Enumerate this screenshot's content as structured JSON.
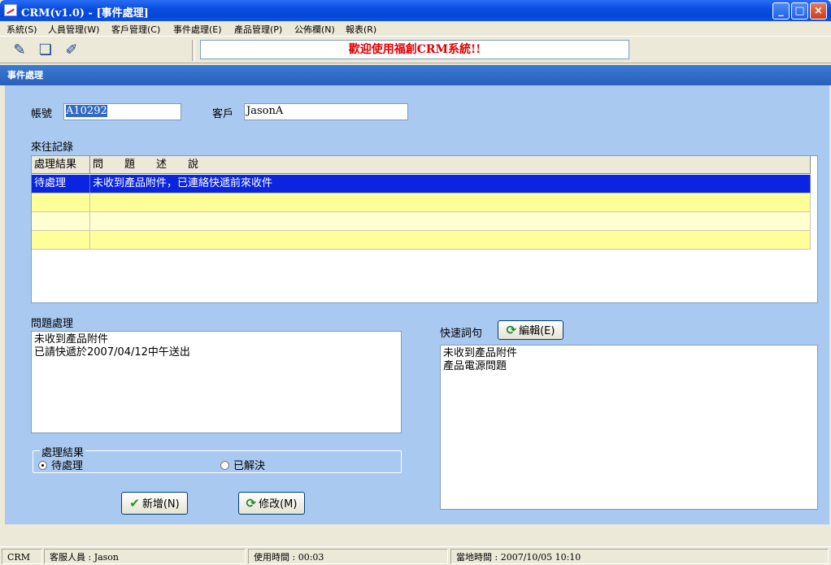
{
  "window": {
    "title": "CRM(v1.0) - [事件處理]",
    "controls": {
      "minimize": "_",
      "maximize": "□",
      "close": "×"
    }
  },
  "menu": [
    "系統(S)",
    "人員管理(W)",
    "客戶管理(C)",
    "事件處理(E)",
    "產品管理(P)",
    "公佈欄(N)",
    "報表(R)"
  ],
  "toolbar": {
    "icons": [
      "edit-icon",
      "book-icon",
      "notepad-icon"
    ],
    "welcome": "歡迎使用福創CRM系統!!"
  },
  "form": {
    "title": "事件處理",
    "account_label": "帳號",
    "account_value": "A10292",
    "customer_label": "客戶",
    "customer_value": "JasonA",
    "records_label": "來往記錄",
    "grid": {
      "headers": [
        "處理結果",
        "問　　題　　述　　說"
      ],
      "rows": [
        [
          "待處理",
          "未收到產品附件，已連絡快遞前來收件"
        ],
        [
          "",
          ""
        ],
        [
          "",
          ""
        ],
        [
          "",
          ""
        ]
      ]
    },
    "problem_label": "問題處理",
    "problem_lines": [
      "未收到產品附件",
      "已請快遞於2007/04/12中午送出"
    ],
    "quick_label": "快速詞句",
    "edit_button": "編輯(E)",
    "quick_lines": [
      "未收到產品附件",
      "產品電源問題"
    ],
    "result_group": "處理結果",
    "radio_pending": "待處理",
    "radio_resolved": "已解決",
    "add_button": "新增(N)",
    "modify_button": "修改(M)"
  },
  "status": {
    "app": "CRM",
    "staff": "客服人員 : Jason",
    "usage": "使用時間 : 00:03",
    "time": "當地時間 : 2007/10/05 10:10"
  },
  "colors": {
    "content_bg": "#a9c9f0",
    "header_blue": "#2a5fb8",
    "selected_row": "#0a24e0",
    "welcome_text": "#e00000"
  }
}
